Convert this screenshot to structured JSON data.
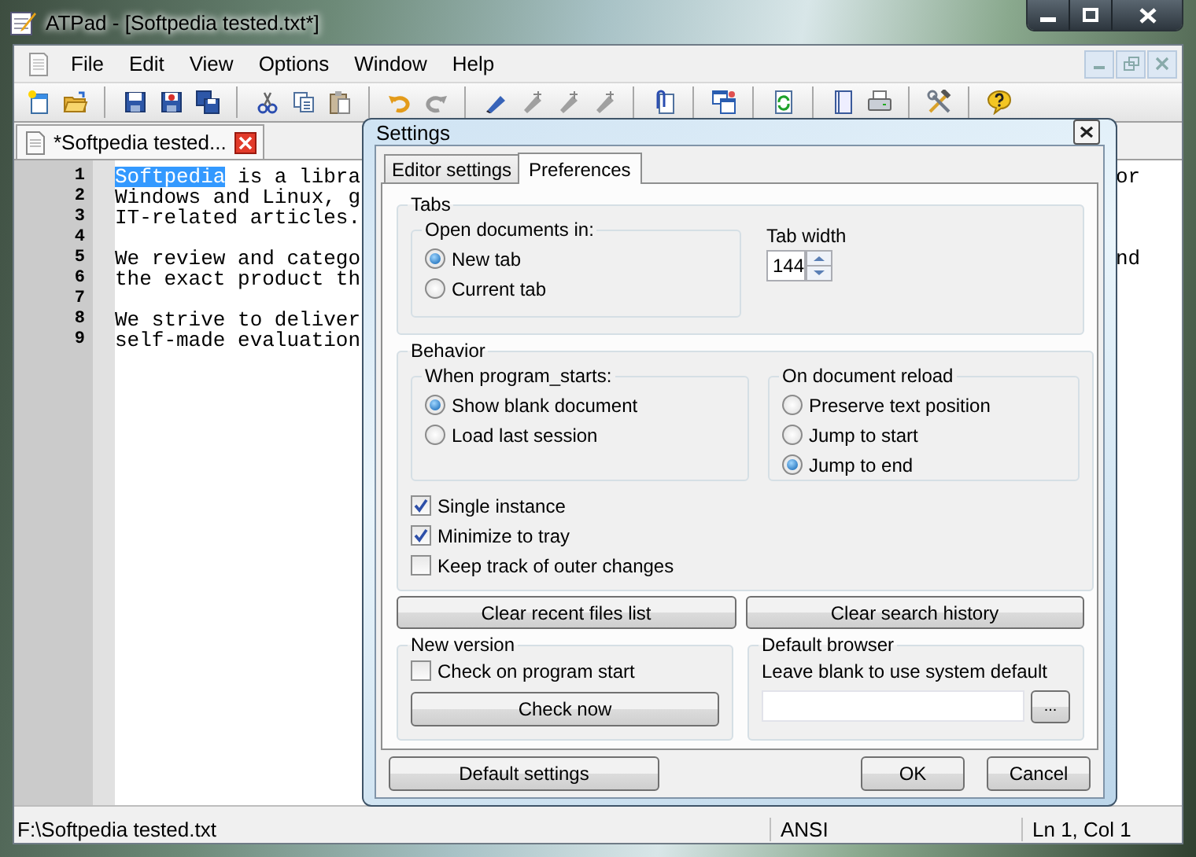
{
  "window": {
    "title": "ATPad - [Softpedia tested.txt*]"
  },
  "menu": [
    "File",
    "Edit",
    "View",
    "Options",
    "Window",
    "Help"
  ],
  "doc_tab": {
    "label": "*Softpedia tested..."
  },
  "editor": {
    "lines": [
      {
        "number": "1",
        "selected_text": "Softpedia",
        "text": " is a libra",
        "right_text": "or"
      },
      {
        "number": "2",
        "text": "Windows and Linux, g"
      },
      {
        "number": "3",
        "text": "IT-related articles."
      },
      {
        "number": "4"
      },
      {
        "number": "5",
        "text": "We review and catego",
        "right_text": "nd"
      },
      {
        "number": "6",
        "text": "the exact product th"
      },
      {
        "number": "7"
      },
      {
        "number": "8",
        "text": "We strive to deliver"
      },
      {
        "number": "9",
        "text": "self-made evaluation"
      }
    ]
  },
  "status_bar": {
    "path": "F:\\Softpedia tested.txt",
    "encoding": "ANSI",
    "position": "Ln 1, Col 1"
  },
  "dialog": {
    "title": "Settings",
    "tabs": [
      {
        "label": "Editor settings",
        "selected": false
      },
      {
        "label": "Preferences",
        "selected": true
      }
    ],
    "tabs_group": {
      "title": "Tabs",
      "open_in": {
        "title": "Open documents in:",
        "options": [
          {
            "label": "New tab",
            "selected": true
          },
          {
            "label": "Current tab",
            "selected": false
          }
        ]
      },
      "tab_width": {
        "label": "Tab width",
        "value": "144"
      }
    },
    "behavior": {
      "title": "Behavior",
      "program_start": {
        "title": "When program_starts:",
        "options": [
          {
            "label": "Show blank document",
            "selected": true
          },
          {
            "label": "Load last session",
            "selected": false
          }
        ]
      },
      "reload": {
        "title": "On document reload",
        "options": [
          {
            "label": "Preserve text position",
            "selected": false
          },
          {
            "label": "Jump to start",
            "selected": false
          },
          {
            "label": "Jump to end",
            "selected": true
          }
        ]
      },
      "checks": [
        {
          "label": "Single instance",
          "checked": true
        },
        {
          "label": "Minimize to tray",
          "checked": true
        },
        {
          "label": "Keep track of outer changes",
          "checked": false
        }
      ]
    },
    "clear_buttons": [
      "Clear recent files list",
      "Clear search history"
    ],
    "new_version": {
      "title": "New version",
      "check": {
        "label": "Check on program start",
        "checked": false
      },
      "button": "Check now"
    },
    "default_browser": {
      "title": "Default browser",
      "hint": "Leave blank to use system default",
      "browse": "..."
    },
    "footer": {
      "reset": "Default settings",
      "ok": "OK",
      "cancel": "Cancel"
    }
  }
}
